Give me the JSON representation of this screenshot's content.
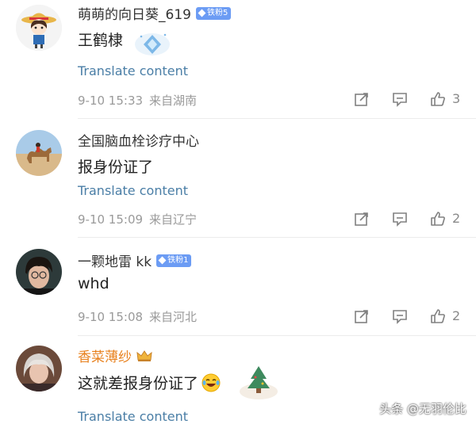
{
  "comments": [
    {
      "username": "萌萌的向日葵_619",
      "badge": "铁粉5",
      "content": "王鹤棣",
      "translate": "Translate content",
      "time": "9-10 15:33",
      "location": "来自湖南",
      "likes": "3",
      "avatar": "cartoon-girl-straw-hat"
    },
    {
      "username": "全国脑血栓诊疗中心",
      "content": "报身份证了",
      "translate": "Translate content",
      "time": "9-10 15:09",
      "location": "来自辽宁",
      "likes": "2",
      "avatar": "camel-desert-photo"
    },
    {
      "username": "一颗地雷 kk",
      "badge": "铁粉1",
      "content": "whd",
      "translate": "",
      "time": "9-10 15:08",
      "location": "来自河北",
      "likes": "2",
      "avatar": "boy-portrait-photo"
    },
    {
      "username": "香菜薄纱",
      "content": "这就差报身份证了",
      "translate": "Translate content",
      "avatar": "elderly-woman-photo"
    }
  ],
  "icons": {
    "share": "share-icon",
    "comment": "comment-icon",
    "like": "thumbs-up-icon",
    "crown": "crown-icon",
    "emoji": "laughing-tears-emoji"
  },
  "colors": {
    "translate_link": "#4a7ea6",
    "badge": "#6c9cf4",
    "gold_username": "#e8811e"
  },
  "watermark": "头条 @无羽伦比"
}
